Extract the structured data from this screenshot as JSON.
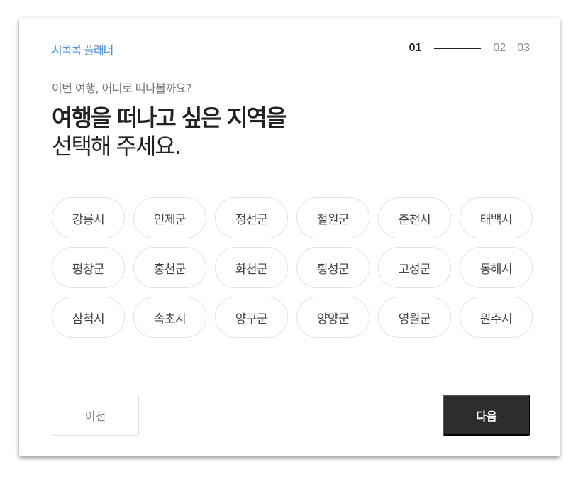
{
  "brand": {
    "logo_text": "시콕콕 플래너",
    "color": "#4a8fd6"
  },
  "steps": {
    "step1": "01",
    "step2": "02",
    "step3": "03",
    "current": 1
  },
  "intro": {
    "subtitle": "이번 여행, 어디로 떠나볼까요?",
    "headline_bold": "여행을 떠나고 싶은 지역을",
    "headline_light": "선택해 주세요."
  },
  "regions": [
    "강릉시",
    "인제군",
    "정선군",
    "철원군",
    "춘천시",
    "태백시",
    "평창군",
    "홍천군",
    "화천군",
    "횡성군",
    "고성군",
    "동해시",
    "삼척시",
    "속초시",
    "양구군",
    "양양군",
    "영월군",
    "원주시"
  ],
  "buttons": {
    "prev_label": "이전",
    "next_label": "다음"
  },
  "colors": {
    "primary_dark": "#2d2d2d",
    "chip_border": "#e2e2e2"
  }
}
